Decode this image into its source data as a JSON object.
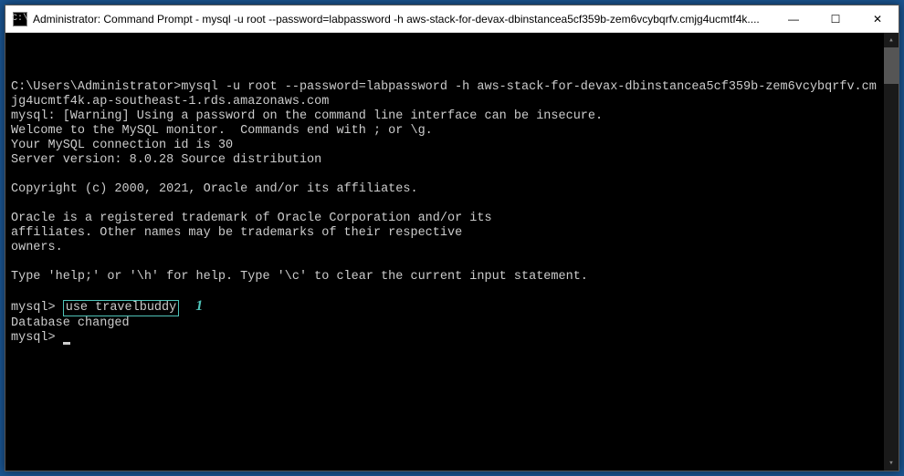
{
  "titlebar": {
    "icon_label": "C:\\",
    "text": "Administrator: Command Prompt - mysql   -u root --password=labpassword -h aws-stack-for-devax-dbinstancea5cf359b-zem6vcybqrfv.cmjg4ucmtf4k...."
  },
  "window_controls": {
    "minimize": "—",
    "maximize": "☐",
    "close": "✕"
  },
  "terminal": {
    "line1": "C:\\Users\\Administrator>mysql -u root --password=labpassword -h aws-stack-for-devax-dbinstancea5cf359b-zem6vcybqrfv.cmjg4ucmtf4k.ap-southeast-1.rds.amazonaws.com",
    "line2": "mysql: [Warning] Using a password on the command line interface can be insecure.",
    "line3": "Welcome to the MySQL monitor.  Commands end with ; or \\g.",
    "line4": "Your MySQL connection id is 30",
    "line5": "Server version: 8.0.28 Source distribution",
    "blank1": "",
    "line6": "Copyright (c) 2000, 2021, Oracle and/or its affiliates.",
    "blank2": "",
    "line7": "Oracle is a registered trademark of Oracle Corporation and/or its",
    "line8": "affiliates. Other names may be trademarks of their respective",
    "line9": "owners.",
    "blank3": "",
    "line10": "Type 'help;' or '\\h' for help. Type '\\c' to clear the current input statement.",
    "blank4": "",
    "prompt1_prefix": "mysql> ",
    "highlighted_command": "use travelbuddy",
    "callout_marker": "1",
    "line11": "Database changed",
    "prompt2": "mysql> "
  }
}
